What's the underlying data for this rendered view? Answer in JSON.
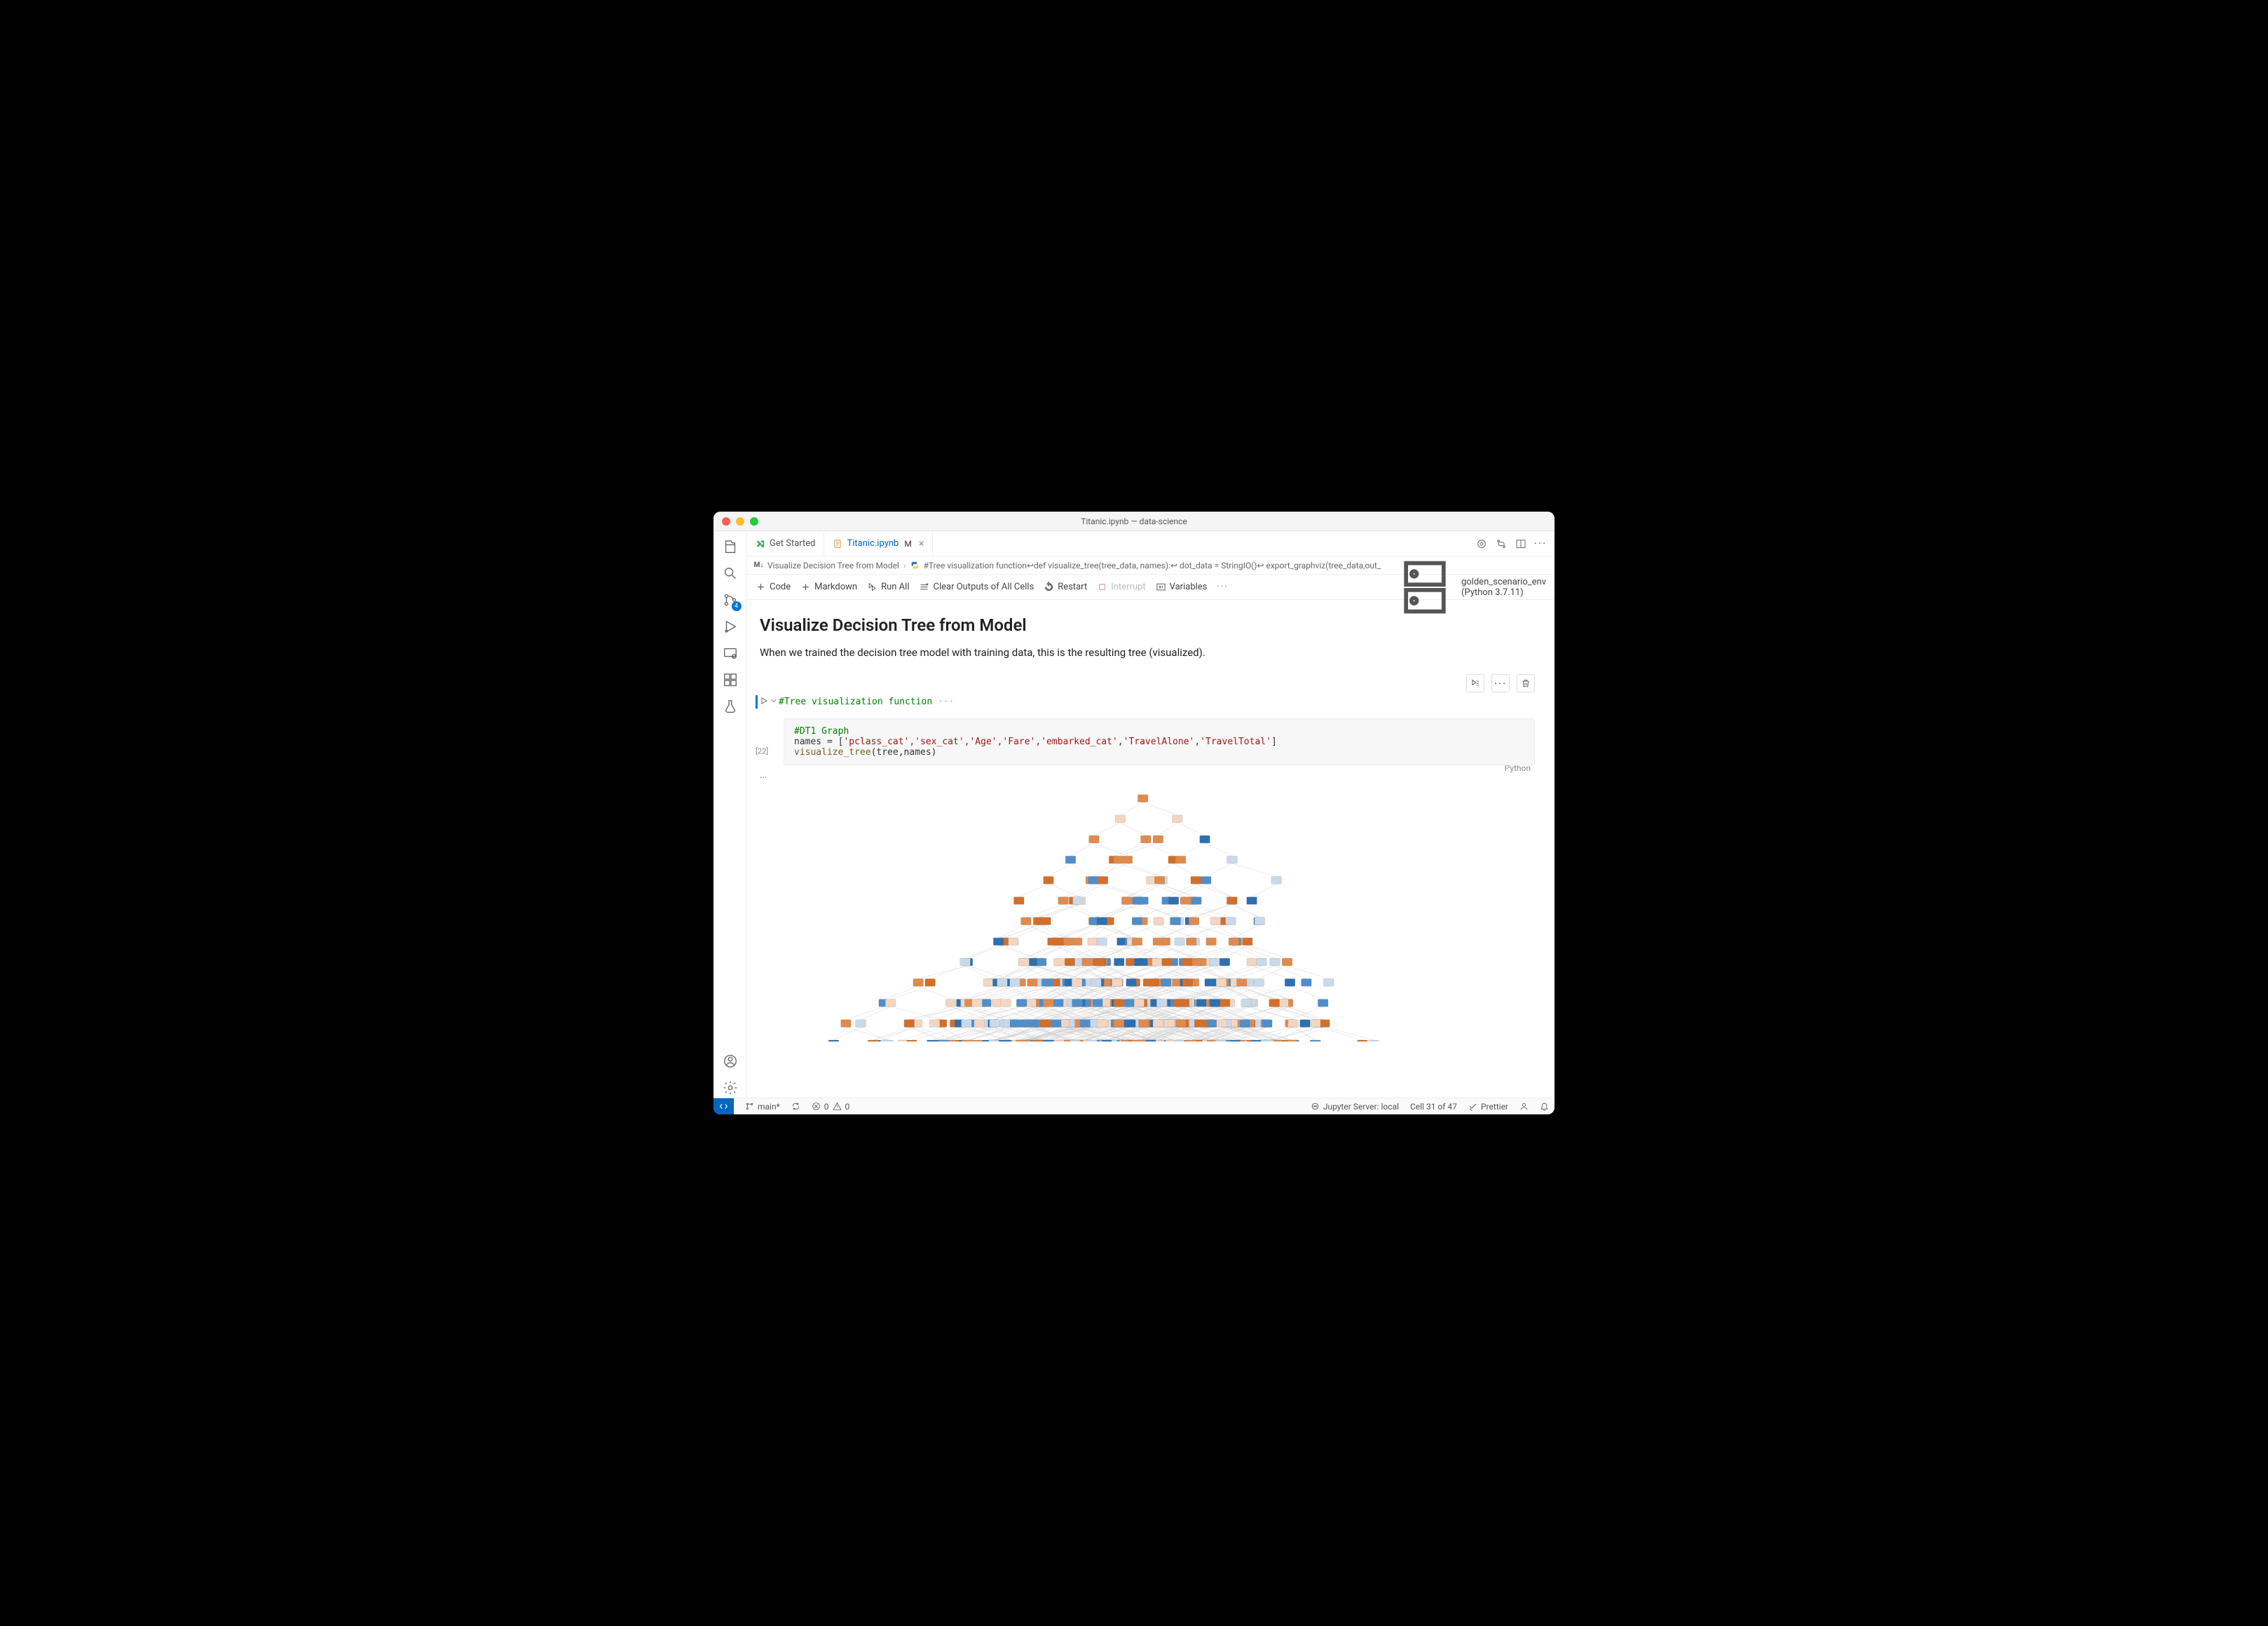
{
  "window": {
    "title": "Titanic.ipynb — data-science"
  },
  "tabs": {
    "getStarted": "Get Started",
    "file": "Titanic.ipynb",
    "modified": "M"
  },
  "breadcrumb": {
    "mdPrefix": "M↓",
    "section": "Visualize Decision Tree from Model",
    "detail": "#Tree visualization function↩def visualize_tree(tree_data, names):↩   dot_data = StringIO()↩   export_graphviz(tree_data,out_"
  },
  "toolbar": {
    "code": "Code",
    "markdown": "Markdown",
    "runAll": "Run All",
    "clear": "Clear Outputs of All Cells",
    "restart": "Restart",
    "interrupt": "Interrupt",
    "variables": "Variables",
    "kernel": "golden_scenario_env (Python 3.7.11)"
  },
  "markdown": {
    "heading": "Visualize Decision Tree from Model",
    "body": "When we trained the decision tree model with training data, this is the resulting tree (visualized)."
  },
  "collapsedCell": {
    "text": "#Tree visualization function",
    "ellipsis": "···"
  },
  "codeCell": {
    "execCount": "[22]",
    "line1": "#DT1 Graph",
    "line2_pre": "names = [",
    "line2_items": "'pclass_cat','sex_cat','Age','Fare','embarked_cat','TravelAlone','TravelTotal'",
    "line2_post": "]",
    "line3_fn": "visualize_tree",
    "line3_args": "(tree,names)",
    "language": "Python"
  },
  "outputEllipsis": "···",
  "activity": {
    "scmBadge": "4"
  },
  "status": {
    "branch": "main*",
    "errors": "0",
    "warnings": "0",
    "jupyter": "Jupyter Server: local",
    "cellPos": "Cell 31 of 47",
    "prettier": "Prettier"
  }
}
